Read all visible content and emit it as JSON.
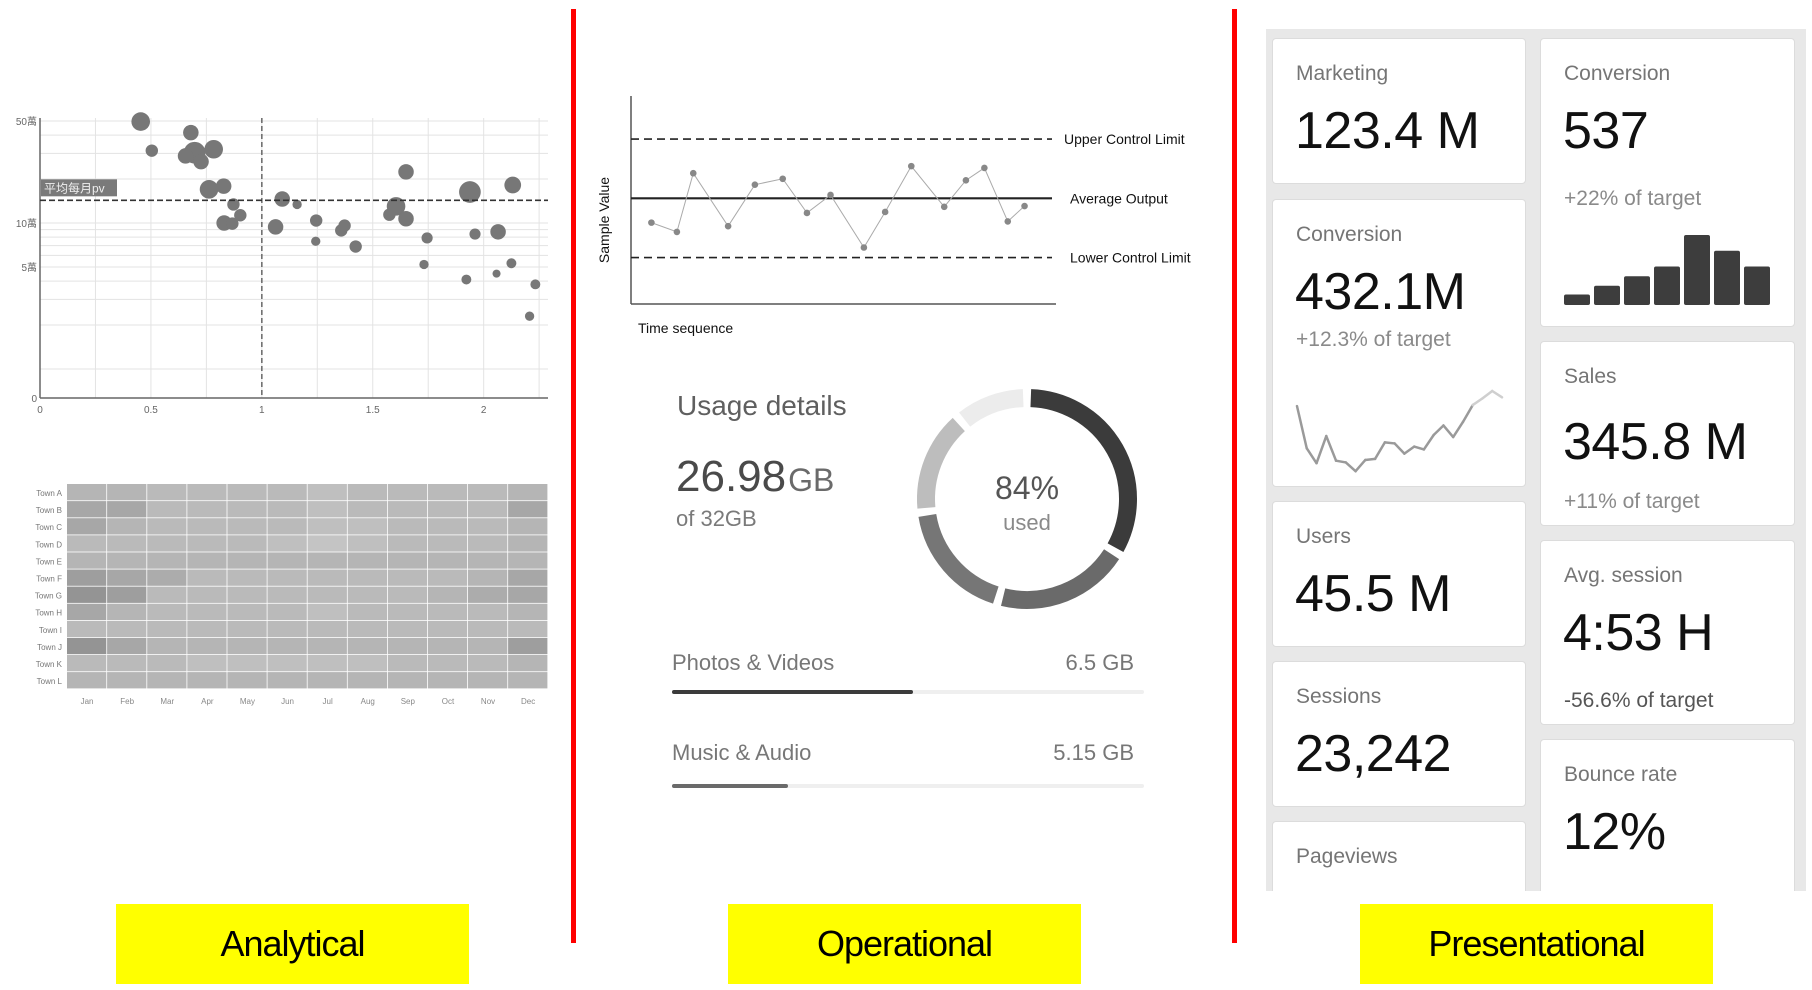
{
  "sections": {
    "analytical": "Analytical",
    "operational": "Operational",
    "presentational": "Presentational"
  },
  "colors": {
    "divider": "#ff0000",
    "section_label_bg": "#ffff00",
    "mark": "#6f6f6f",
    "bar_dark": "#3d3d3d"
  },
  "chart_data": [
    {
      "type": "scatter",
      "y_scale": "log",
      "xlim": [
        0,
        2.29
      ],
      "ylim": [
        0.63,
        55
      ],
      "x_ticks": [
        "0",
        "0.5",
        "1",
        "1.5",
        "2"
      ],
      "x_tick_values": [
        0,
        0.5,
        1,
        1.5,
        2
      ],
      "y_ticks": [
        "0",
        "5萬",
        "10萬",
        "50萬"
      ],
      "y_tick_values": [
        0.63,
        5,
        10,
        50
      ],
      "grid": true,
      "reference_lines": {
        "horizontal": {
          "value": 14.3,
          "label": "平均每月pv"
        },
        "vertical": {
          "value": 1
        }
      },
      "points": [
        {
          "x": 0.454,
          "y": 49.5,
          "size": 3
        },
        {
          "x": 0.504,
          "y": 31.3,
          "size": 2
        },
        {
          "x": 0.68,
          "y": 41.6,
          "size": 2.5
        },
        {
          "x": 0.697,
          "y": 30.3,
          "size": 3.5
        },
        {
          "x": 0.656,
          "y": 28.8,
          "size": 2.5
        },
        {
          "x": 0.726,
          "y": 26.3,
          "size": 2.5
        },
        {
          "x": 0.783,
          "y": 32,
          "size": 3
        },
        {
          "x": 0.762,
          "y": 17,
          "size": 3
        },
        {
          "x": 0.828,
          "y": 17.9,
          "size": 2.5
        },
        {
          "x": 0.872,
          "y": 13.4,
          "size": 2
        },
        {
          "x": 0.903,
          "y": 11.3,
          "size": 2
        },
        {
          "x": 0.83,
          "y": 10,
          "size": 2.5
        },
        {
          "x": 0.867,
          "y": 9.9,
          "size": 2
        },
        {
          "x": 1.092,
          "y": 14.6,
          "size": 2.5
        },
        {
          "x": 1.159,
          "y": 13.4,
          "size": 1.5
        },
        {
          "x": 1.062,
          "y": 9.4,
          "size": 2.5
        },
        {
          "x": 1.245,
          "y": 10.4,
          "size": 2
        },
        {
          "x": 1.243,
          "y": 7.5,
          "size": 1.5
        },
        {
          "x": 1.358,
          "y": 8.9,
          "size": 2
        },
        {
          "x": 1.373,
          "y": 9.6,
          "size": 2
        },
        {
          "x": 1.423,
          "y": 6.9,
          "size": 2
        },
        {
          "x": 1.65,
          "y": 22.4,
          "size": 2.5
        },
        {
          "x": 1.605,
          "y": 13,
          "size": 3
        },
        {
          "x": 1.575,
          "y": 11.4,
          "size": 2
        },
        {
          "x": 1.65,
          "y": 10.7,
          "size": 2.5
        },
        {
          "x": 1.745,
          "y": 7.9,
          "size": 1.8
        },
        {
          "x": 1.731,
          "y": 5.2,
          "size": 1.5
        },
        {
          "x": 1.938,
          "y": 16.3,
          "size": 3.5
        },
        {
          "x": 2.131,
          "y": 18.2,
          "size": 2.7
        },
        {
          "x": 1.961,
          "y": 8.4,
          "size": 1.8
        },
        {
          "x": 2.065,
          "y": 8.7,
          "size": 2.5
        },
        {
          "x": 2.125,
          "y": 5.3,
          "size": 1.6
        },
        {
          "x": 2.058,
          "y": 4.5,
          "size": 1.3
        },
        {
          "x": 1.922,
          "y": 4.1,
          "size": 1.6
        },
        {
          "x": 2.233,
          "y": 3.8,
          "size": 1.6
        },
        {
          "x": 2.207,
          "y": 2.3,
          "size": 1.5
        }
      ]
    },
    {
      "type": "heatmap",
      "columns": [
        "Jan",
        "Feb",
        "Mar",
        "Apr",
        "May",
        "Jun",
        "Jul",
        "Aug",
        "Sep",
        "Oct",
        "Nov",
        "Dec"
      ],
      "rows": [
        "Town A",
        "Town B",
        "Town C",
        "Town D",
        "Town E",
        "Town F",
        "Town G",
        "Town H",
        "Town I",
        "Town J",
        "Town K",
        "Town L"
      ],
      "values": [
        [
          2.5,
          2.5,
          2,
          2,
          2,
          2,
          1.5,
          2,
          2,
          2,
          2,
          2.5
        ],
        [
          4,
          4,
          2,
          2,
          2,
          2,
          1.5,
          2,
          2,
          2,
          2,
          4
        ],
        [
          4,
          2.5,
          2,
          2,
          2,
          2,
          1.5,
          1.5,
          2,
          2,
          2,
          2.5
        ],
        [
          2,
          2,
          2,
          2,
          2,
          1.5,
          1,
          1.5,
          2,
          2,
          2,
          2.5
        ],
        [
          2.5,
          2.5,
          2.5,
          2.5,
          2.5,
          2.5,
          2.5,
          2.5,
          2.5,
          2.5,
          2.5,
          2.5
        ],
        [
          5,
          4,
          3.5,
          2,
          2,
          2,
          2,
          2,
          2,
          2,
          2.5,
          4
        ],
        [
          6,
          5,
          2,
          2,
          2,
          2,
          2,
          2,
          2,
          2.5,
          3.5,
          4
        ],
        [
          4,
          2.5,
          2,
          2,
          2,
          2,
          1.5,
          2,
          2,
          2,
          2,
          2.5
        ],
        [
          2,
          2,
          2,
          2,
          2,
          2,
          2,
          2,
          2,
          2,
          2,
          2
        ],
        [
          6,
          4,
          2.5,
          2.5,
          2.5,
          2.5,
          2.5,
          2.5,
          2.5,
          2.5,
          2.5,
          5
        ],
        [
          2,
          2,
          2,
          1.5,
          1.5,
          1.5,
          1.5,
          1.5,
          2,
          2,
          2,
          2.5
        ],
        [
          2.5,
          2.5,
          2.5,
          2.5,
          2.5,
          2.5,
          2.5,
          2.5,
          2.5,
          2.5,
          2.5,
          2.5
        ]
      ]
    },
    {
      "type": "line",
      "xlabel": "Time sequence",
      "ylabel": "Sample Value",
      "xlim": [
        0,
        20
      ],
      "ylim": [
        -5.35,
        5.18
      ],
      "control_lines": [
        {
          "label": "Upper Control Limit",
          "value": 3,
          "style": "dashed"
        },
        {
          "label": "Average Output",
          "value": 0,
          "style": "solid"
        },
        {
          "label": "Lower Control Limit",
          "value": -3,
          "style": "dashed"
        }
      ],
      "x": [
        0.96,
        2.16,
        2.93,
        4.57,
        5.83,
        7.14,
        8.28,
        9.39,
        10.96,
        11.96,
        13.19,
        14.74,
        15.76,
        16.63,
        17.73,
        18.52
      ],
      "y": [
        -1.23,
        -1.7,
        1.27,
        -1.41,
        0.69,
        0.99,
        -0.74,
        0.17,
        -2.49,
        -0.69,
        1.63,
        -0.43,
        0.91,
        1.54,
        -1.17,
        -0.39
      ]
    },
    {
      "type": "pie",
      "variant": "donut",
      "center_value": "84%",
      "center_label": "used",
      "segments": [
        {
          "fraction": 0.336,
          "color": "#3b3b3b"
        },
        {
          "fraction": 0.208,
          "color": "#6a6a6a"
        },
        {
          "fraction": 0.186,
          "color": "#767676"
        },
        {
          "fraction": 0.158,
          "color": "#bdbdbd"
        },
        {
          "fraction": 0.112,
          "color": "#ececec"
        }
      ]
    }
  ],
  "usage": {
    "title": "Usage details",
    "used_value": "26.98",
    "used_unit": "GB",
    "total": "of 32GB",
    "items": [
      {
        "label": "Photos & Videos",
        "value": "6.5 GB",
        "progress": 0.51,
        "color": "#3b3b3b"
      },
      {
        "label": "Music & Audio",
        "value": "5.15 GB",
        "progress": 0.245,
        "color": "#6a6a6a"
      }
    ]
  },
  "cards": {
    "marketing": {
      "label": "Marketing",
      "value": "123.4 M"
    },
    "conversion_a": {
      "label": "Conversion",
      "value": "432.1M",
      "sub": "+12.3% of target",
      "sparkline": [
        190,
        70,
        28,
        105,
        35,
        30,
        5,
        37,
        40,
        87,
        84,
        55,
        75,
        67,
        108,
        135,
        102,
        145,
        193,
        212,
        233,
        215
      ]
    },
    "users": {
      "label": "Users",
      "value": "45.5 M"
    },
    "sessions": {
      "label": "Sessions",
      "value": "23,242"
    },
    "pageviews": {
      "label": "Pageviews"
    },
    "conversion_b": {
      "label": "Conversion",
      "value": "537",
      "sub": "+22% of target",
      "bars": [
        3,
        5.5,
        8.2,
        11,
        20,
        15.5,
        11
      ]
    },
    "sales": {
      "label": "Sales",
      "value": "345.8 M",
      "sub": "+11% of target"
    },
    "avg_session": {
      "label": "Avg. session",
      "value": "4:53 H",
      "sub": "-56.6% of target"
    },
    "bounce_rate": {
      "label": "Bounce rate",
      "value": "12%"
    }
  }
}
